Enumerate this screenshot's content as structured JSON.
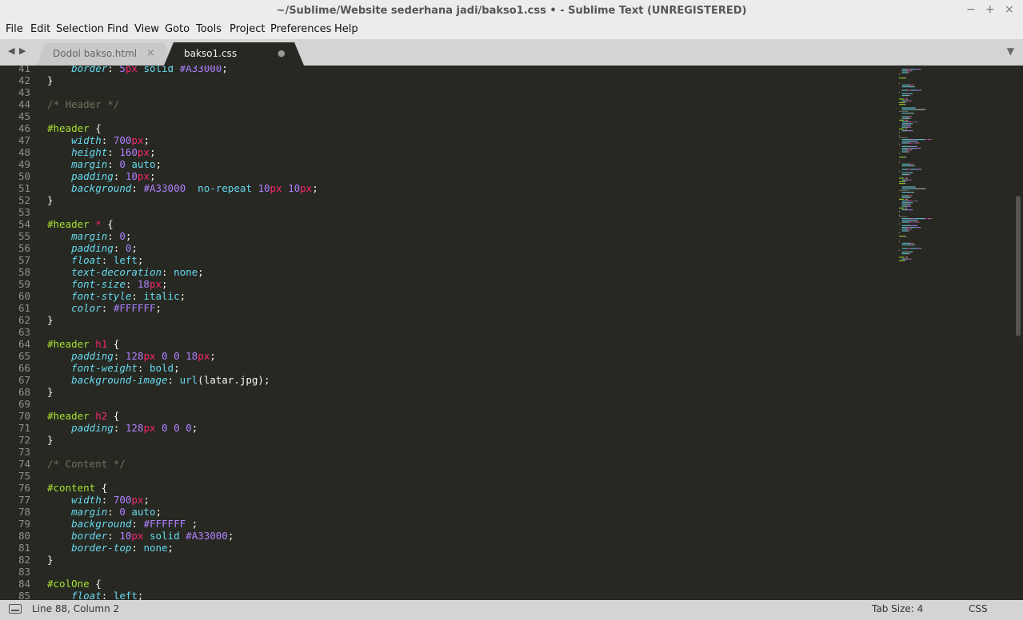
{
  "window": {
    "title": "~/Sublime/Website sederhana jadi/bakso1.css • - Sublime Text (UNREGISTERED)",
    "controls": {
      "minimize": "−",
      "maximize": "+",
      "close": "×"
    }
  },
  "menu": [
    "File",
    "Edit",
    "Selection",
    "Find",
    "View",
    "Goto",
    "Tools",
    "Project",
    "Preferences",
    "Help"
  ],
  "tabs": [
    {
      "label": "Dodol bakso.html",
      "close": "×",
      "active": false
    },
    {
      "label": "bakso1.css",
      "close": "●",
      "active": true,
      "dirty": true
    }
  ],
  "nav": {
    "back": "◀",
    "forward": "▶",
    "tab_menu": "▼"
  },
  "editor": {
    "line_start": 41,
    "lines": [
      [
        [
          "    ",
          "plain"
        ],
        [
          "border",
          "prop"
        ],
        [
          ": ",
          "plain"
        ],
        [
          "5",
          "num"
        ],
        [
          "px",
          "unit"
        ],
        [
          " solid ",
          "kw"
        ],
        [
          "#A33000",
          "color"
        ],
        [
          ";",
          "plain"
        ]
      ],
      [
        [
          "}",
          "brace"
        ]
      ],
      [],
      [
        [
          "/* Header */",
          "comment"
        ]
      ],
      [],
      [
        [
          "#header",
          "sel"
        ],
        [
          " {",
          "brace"
        ]
      ],
      [
        [
          "    ",
          "plain"
        ],
        [
          "width",
          "prop"
        ],
        [
          ": ",
          "plain"
        ],
        [
          "700",
          "num"
        ],
        [
          "px",
          "unit"
        ],
        [
          ";",
          "plain"
        ]
      ],
      [
        [
          "    ",
          "plain"
        ],
        [
          "height",
          "prop"
        ],
        [
          ": ",
          "plain"
        ],
        [
          "160",
          "num"
        ],
        [
          "px",
          "unit"
        ],
        [
          ";",
          "plain"
        ]
      ],
      [
        [
          "    ",
          "plain"
        ],
        [
          "margin",
          "prop"
        ],
        [
          ": ",
          "plain"
        ],
        [
          "0",
          "num"
        ],
        [
          " auto",
          "kw"
        ],
        [
          ";",
          "plain"
        ]
      ],
      [
        [
          "    ",
          "plain"
        ],
        [
          "padding",
          "prop"
        ],
        [
          ": ",
          "plain"
        ],
        [
          "10",
          "num"
        ],
        [
          "px",
          "unit"
        ],
        [
          ";",
          "plain"
        ]
      ],
      [
        [
          "    ",
          "plain"
        ],
        [
          "background",
          "prop"
        ],
        [
          ": ",
          "plain"
        ],
        [
          "#A33000",
          "color"
        ],
        [
          "  no-repeat ",
          "kw"
        ],
        [
          "10",
          "num"
        ],
        [
          "px",
          "unit"
        ],
        [
          " ",
          "plain"
        ],
        [
          "10",
          "num"
        ],
        [
          "px",
          "unit"
        ],
        [
          ";",
          "plain"
        ]
      ],
      [
        [
          "}",
          "brace"
        ]
      ],
      [],
      [
        [
          "#header",
          "sel"
        ],
        [
          " ",
          "plain"
        ],
        [
          "*",
          "tag"
        ],
        [
          " {",
          "brace"
        ]
      ],
      [
        [
          "    ",
          "plain"
        ],
        [
          "margin",
          "prop"
        ],
        [
          ": ",
          "plain"
        ],
        [
          "0",
          "num"
        ],
        [
          ";",
          "plain"
        ]
      ],
      [
        [
          "    ",
          "plain"
        ],
        [
          "padding",
          "prop"
        ],
        [
          ": ",
          "plain"
        ],
        [
          "0",
          "num"
        ],
        [
          ";",
          "plain"
        ]
      ],
      [
        [
          "    ",
          "plain"
        ],
        [
          "float",
          "prop"
        ],
        [
          ": ",
          "plain"
        ],
        [
          "left",
          "kw"
        ],
        [
          ";",
          "plain"
        ]
      ],
      [
        [
          "    ",
          "plain"
        ],
        [
          "text-decoration",
          "prop"
        ],
        [
          ": ",
          "plain"
        ],
        [
          "none",
          "kw"
        ],
        [
          ";",
          "plain"
        ]
      ],
      [
        [
          "    ",
          "plain"
        ],
        [
          "font-size",
          "prop"
        ],
        [
          ": ",
          "plain"
        ],
        [
          "18",
          "num"
        ],
        [
          "px",
          "unit"
        ],
        [
          ";",
          "plain"
        ]
      ],
      [
        [
          "    ",
          "plain"
        ],
        [
          "font-style",
          "prop"
        ],
        [
          ": ",
          "plain"
        ],
        [
          "italic",
          "kw"
        ],
        [
          ";",
          "plain"
        ]
      ],
      [
        [
          "    ",
          "plain"
        ],
        [
          "color",
          "prop"
        ],
        [
          ": ",
          "plain"
        ],
        [
          "#FFFFFF",
          "color"
        ],
        [
          ";",
          "plain"
        ]
      ],
      [
        [
          "}",
          "brace"
        ]
      ],
      [],
      [
        [
          "#header",
          "sel"
        ],
        [
          " ",
          "plain"
        ],
        [
          "h1",
          "tag"
        ],
        [
          " {",
          "brace"
        ]
      ],
      [
        [
          "    ",
          "plain"
        ],
        [
          "padding",
          "prop"
        ],
        [
          ": ",
          "plain"
        ],
        [
          "128",
          "num"
        ],
        [
          "px",
          "unit"
        ],
        [
          " ",
          "plain"
        ],
        [
          "0",
          "num"
        ],
        [
          " ",
          "plain"
        ],
        [
          "0",
          "num"
        ],
        [
          " ",
          "plain"
        ],
        [
          "18",
          "num"
        ],
        [
          "px",
          "unit"
        ],
        [
          ";",
          "plain"
        ]
      ],
      [
        [
          "    ",
          "plain"
        ],
        [
          "font-weight",
          "prop"
        ],
        [
          ": ",
          "plain"
        ],
        [
          "bold",
          "kw"
        ],
        [
          ";",
          "plain"
        ]
      ],
      [
        [
          "    ",
          "plain"
        ],
        [
          "background-image",
          "prop"
        ],
        [
          ": ",
          "plain"
        ],
        [
          "url",
          "func"
        ],
        [
          "(latar.jpg);",
          "plain"
        ]
      ],
      [
        [
          "}",
          "brace"
        ]
      ],
      [],
      [
        [
          "#header",
          "sel"
        ],
        [
          " ",
          "plain"
        ],
        [
          "h2",
          "tag"
        ],
        [
          " {",
          "brace"
        ]
      ],
      [
        [
          "    ",
          "plain"
        ],
        [
          "padding",
          "prop"
        ],
        [
          ": ",
          "plain"
        ],
        [
          "128",
          "num"
        ],
        [
          "px",
          "unit"
        ],
        [
          " ",
          "plain"
        ],
        [
          "0",
          "num"
        ],
        [
          " ",
          "plain"
        ],
        [
          "0",
          "num"
        ],
        [
          " ",
          "plain"
        ],
        [
          "0",
          "num"
        ],
        [
          ";",
          "plain"
        ]
      ],
      [
        [
          "}",
          "brace"
        ]
      ],
      [],
      [
        [
          "/* Content */",
          "comment"
        ]
      ],
      [],
      [
        [
          "#content",
          "sel"
        ],
        [
          " {",
          "brace"
        ]
      ],
      [
        [
          "    ",
          "plain"
        ],
        [
          "width",
          "prop"
        ],
        [
          ": ",
          "plain"
        ],
        [
          "700",
          "num"
        ],
        [
          "px",
          "unit"
        ],
        [
          ";",
          "plain"
        ]
      ],
      [
        [
          "    ",
          "plain"
        ],
        [
          "margin",
          "prop"
        ],
        [
          ": ",
          "plain"
        ],
        [
          "0",
          "num"
        ],
        [
          " auto",
          "kw"
        ],
        [
          ";",
          "plain"
        ]
      ],
      [
        [
          "    ",
          "plain"
        ],
        [
          "background",
          "prop"
        ],
        [
          ": ",
          "plain"
        ],
        [
          "#FFFFFF",
          "color"
        ],
        [
          " ;",
          "plain"
        ]
      ],
      [
        [
          "    ",
          "plain"
        ],
        [
          "border",
          "prop"
        ],
        [
          ": ",
          "plain"
        ],
        [
          "10",
          "num"
        ],
        [
          "px",
          "unit"
        ],
        [
          " solid ",
          "kw"
        ],
        [
          "#A33000",
          "color"
        ],
        [
          ";",
          "plain"
        ]
      ],
      [
        [
          "    ",
          "plain"
        ],
        [
          "border-top",
          "prop"
        ],
        [
          ": ",
          "plain"
        ],
        [
          "none",
          "kw"
        ],
        [
          ";",
          "plain"
        ]
      ],
      [
        [
          "}",
          "brace"
        ]
      ],
      [],
      [
        [
          "#colOne",
          "sel"
        ],
        [
          " {",
          "brace"
        ]
      ],
      [
        [
          "    ",
          "plain"
        ],
        [
          "float",
          "prop"
        ],
        [
          ": ",
          "plain"
        ],
        [
          "left",
          "kw"
        ],
        [
          ";",
          "plain"
        ]
      ]
    ]
  },
  "status": {
    "position": "Line 88, Column 2",
    "tab_size": "Tab Size: 4",
    "syntax": "CSS"
  },
  "colors": {
    "background": "#272822",
    "comment": "#75715e",
    "selector": "#a6e22e",
    "tag": "#f92672",
    "property": "#66d9ef",
    "number": "#ae81ff"
  }
}
